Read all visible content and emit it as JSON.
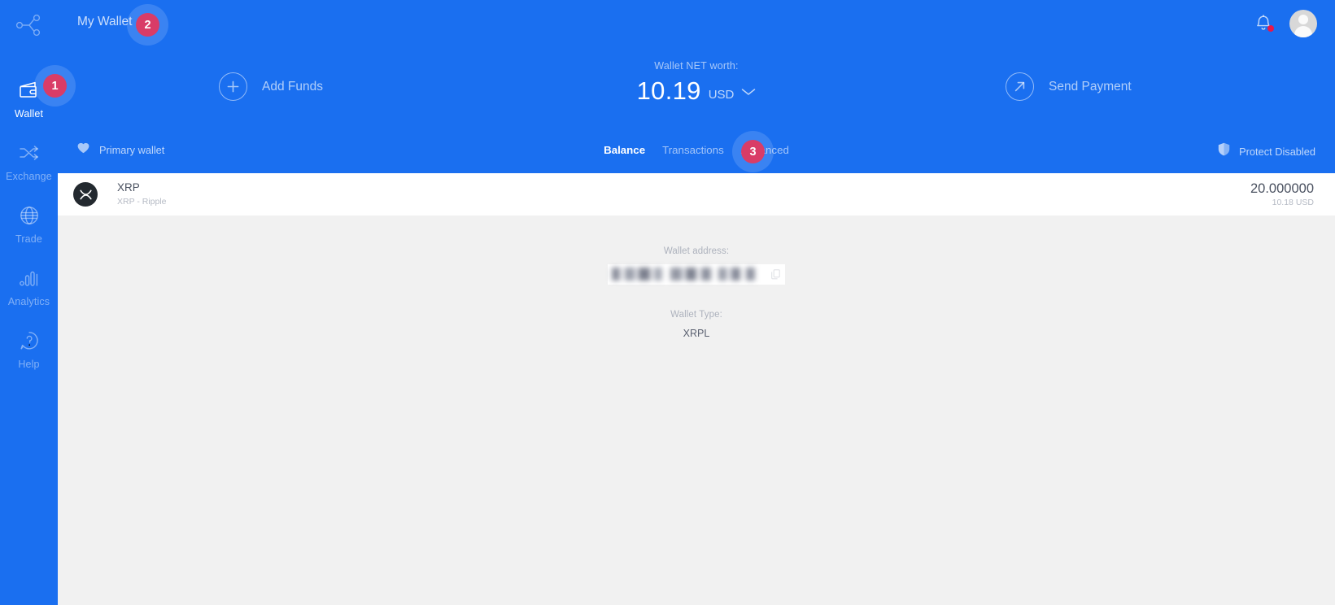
{
  "brand": {
    "accent_blue": "#1a6ff0",
    "badge_red": "#d31c4e",
    "panel_gray": "#f1f1f1",
    "coin_dark": "#23292f"
  },
  "sidebar": {
    "logo_icon": "network-share-icon",
    "items": [
      {
        "label": "Wallet",
        "icon": "wallet-icon",
        "active": true
      },
      {
        "label": "Exchange",
        "icon": "exchange-icon",
        "active": false
      },
      {
        "label": "Trade",
        "icon": "globe-icon",
        "active": false
      },
      {
        "label": "Analytics",
        "icon": "bar-chart-icon",
        "active": false
      },
      {
        "label": "Help",
        "icon": "help-icon",
        "active": false
      }
    ]
  },
  "topbar": {
    "wallet_selector_label": "My Wallet",
    "wallet_selector_icon": "chevron-down-icon",
    "notifications_icon": "bell-icon",
    "notifications_has_unread": true,
    "avatar_icon": "user-avatar-icon"
  },
  "hero": {
    "add_funds_label": "Add Funds",
    "add_funds_icon": "plus-circle-icon",
    "send_payment_label": "Send Payment",
    "send_payment_icon": "arrow-up-right-circle-icon",
    "net_worth_label": "Wallet NET worth:",
    "net_worth_amount": "10.19",
    "net_worth_currency": "USD",
    "currency_chevron_icon": "chevron-down-icon"
  },
  "subnav": {
    "primary_wallet_label": "Primary wallet",
    "primary_wallet_icon": "heart-icon",
    "tabs": [
      {
        "label": "Balance",
        "active": true
      },
      {
        "label": "Transactions",
        "active": false
      },
      {
        "label": "Advanced",
        "active": false
      }
    ],
    "protect_label": "Protect Disabled",
    "protect_icon": "shield-icon"
  },
  "asset": {
    "logo_icon": "xrp-logo-icon",
    "symbol": "XRP",
    "full_name": "XRP - Ripple",
    "amount": "20.000000",
    "fiat_value": "10.18 USD"
  },
  "detail": {
    "address_label": "Wallet address:",
    "address_value": "",
    "address_redacted": true,
    "copy_icon": "copy-icon",
    "wallet_type_label": "Wallet Type:",
    "wallet_type_value": "XRPL"
  },
  "annotations": [
    {
      "number": "1",
      "target": "sidebar-item-wallet"
    },
    {
      "number": "2",
      "target": "wallet-selector"
    },
    {
      "number": "3",
      "target": "tab-advanced"
    }
  ]
}
